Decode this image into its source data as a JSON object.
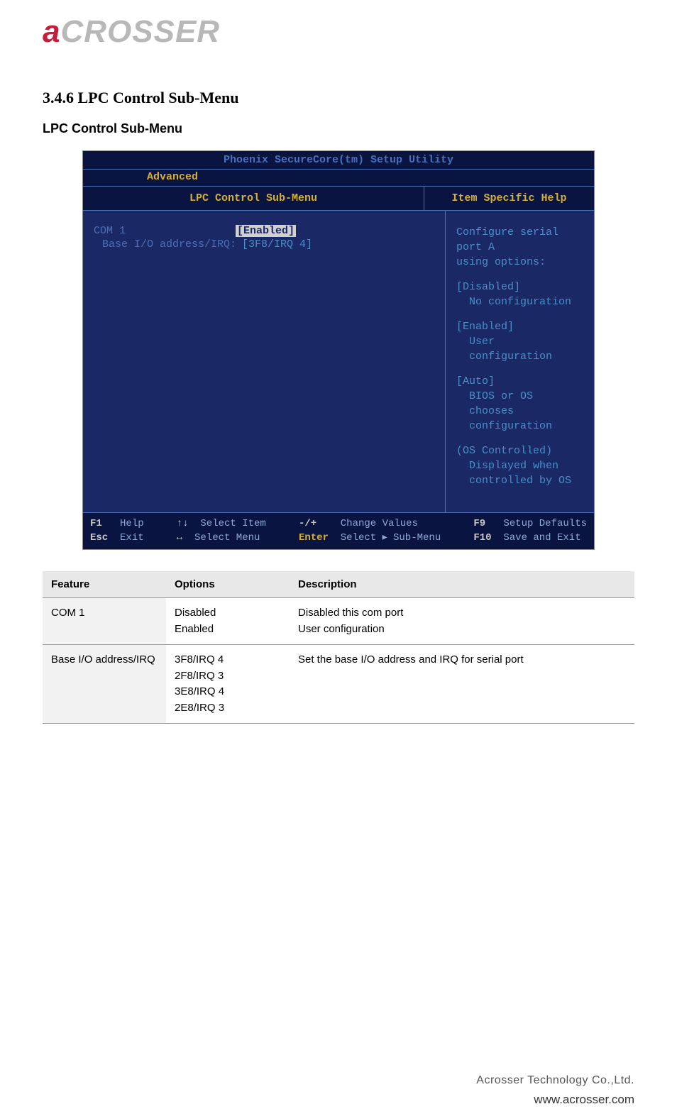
{
  "logo": {
    "first_letter": "a",
    "rest": "CROSSER"
  },
  "section_number_title": "3.4.6 LPC Control Sub-Menu",
  "subsection_title": "LPC Control Sub-Menu",
  "bios": {
    "title": "Phoenix SecureCore(tm) Setup Utility",
    "active_tab": "Advanced",
    "left_panel_title": "LPC Control Sub-Menu",
    "right_panel_title": "Item Specific Help",
    "options": [
      {
        "label": "COM 1",
        "value": "[Enabled]",
        "selected": true
      },
      {
        "label": "Base I/O address/IRQ:",
        "value": "[3F8/IRQ 4]",
        "selected": false
      }
    ],
    "help": {
      "intro1": "Configure serial port A",
      "intro2": "using options:",
      "blocks": [
        {
          "head": "[Disabled]",
          "body": "No configuration"
        },
        {
          "head": "[Enabled]",
          "body": "User configuration"
        },
        {
          "head": "[Auto]",
          "body1": "BIOS or OS chooses",
          "body2": "configuration"
        },
        {
          "head": "(OS Controlled)",
          "body1": "Displayed when",
          "body2": "controlled by OS"
        }
      ]
    },
    "footer": {
      "f1": "F1",
      "help": "Help",
      "updown": "↑↓",
      "select_item": "Select Item",
      "pm": "-/+",
      "change_values": "Change Values",
      "f9": "F9",
      "setup_defaults": "Setup Defaults",
      "esc": "Esc",
      "exit": "Exit",
      "lr": "↔",
      "select_menu": "Select Menu",
      "enter": "Enter",
      "select_sub": "Select ▸ Sub-Menu",
      "f10": "F10",
      "save_exit": "Save and Exit"
    }
  },
  "table": {
    "headers": [
      "Feature",
      "Options",
      "Description"
    ],
    "rows": [
      {
        "feature": "COM 1",
        "options": "Disabled\nEnabled",
        "description": "Disabled this com port\nUser configuration"
      },
      {
        "feature": "Base I/O address/IRQ",
        "options": "3F8/IRQ 4\n2F8/IRQ 3\n3E8/IRQ 4\n2E8/IRQ 3",
        "description": "Set the base I/O address and IRQ for serial port"
      }
    ]
  },
  "footer": {
    "company": "Acrosser Technology Co.,Ltd.",
    "url": "www.acrosser.com"
  }
}
